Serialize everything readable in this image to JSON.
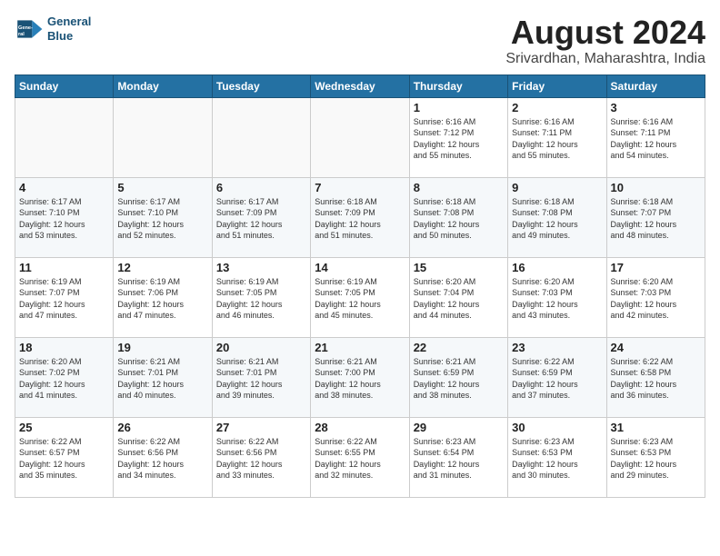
{
  "header": {
    "logo": {
      "line1": "General",
      "line2": "Blue"
    },
    "title": "August 2024",
    "subtitle": "Srivardhan, Maharashtra, India"
  },
  "weekdays": [
    "Sunday",
    "Monday",
    "Tuesday",
    "Wednesday",
    "Thursday",
    "Friday",
    "Saturday"
  ],
  "weeks": [
    [
      {
        "day": "",
        "info": ""
      },
      {
        "day": "",
        "info": ""
      },
      {
        "day": "",
        "info": ""
      },
      {
        "day": "",
        "info": ""
      },
      {
        "day": "1",
        "info": "Sunrise: 6:16 AM\nSunset: 7:12 PM\nDaylight: 12 hours\nand 55 minutes."
      },
      {
        "day": "2",
        "info": "Sunrise: 6:16 AM\nSunset: 7:11 PM\nDaylight: 12 hours\nand 55 minutes."
      },
      {
        "day": "3",
        "info": "Sunrise: 6:16 AM\nSunset: 7:11 PM\nDaylight: 12 hours\nand 54 minutes."
      }
    ],
    [
      {
        "day": "4",
        "info": "Sunrise: 6:17 AM\nSunset: 7:10 PM\nDaylight: 12 hours\nand 53 minutes."
      },
      {
        "day": "5",
        "info": "Sunrise: 6:17 AM\nSunset: 7:10 PM\nDaylight: 12 hours\nand 52 minutes."
      },
      {
        "day": "6",
        "info": "Sunrise: 6:17 AM\nSunset: 7:09 PM\nDaylight: 12 hours\nand 51 minutes."
      },
      {
        "day": "7",
        "info": "Sunrise: 6:18 AM\nSunset: 7:09 PM\nDaylight: 12 hours\nand 51 minutes."
      },
      {
        "day": "8",
        "info": "Sunrise: 6:18 AM\nSunset: 7:08 PM\nDaylight: 12 hours\nand 50 minutes."
      },
      {
        "day": "9",
        "info": "Sunrise: 6:18 AM\nSunset: 7:08 PM\nDaylight: 12 hours\nand 49 minutes."
      },
      {
        "day": "10",
        "info": "Sunrise: 6:18 AM\nSunset: 7:07 PM\nDaylight: 12 hours\nand 48 minutes."
      }
    ],
    [
      {
        "day": "11",
        "info": "Sunrise: 6:19 AM\nSunset: 7:07 PM\nDaylight: 12 hours\nand 47 minutes."
      },
      {
        "day": "12",
        "info": "Sunrise: 6:19 AM\nSunset: 7:06 PM\nDaylight: 12 hours\nand 47 minutes."
      },
      {
        "day": "13",
        "info": "Sunrise: 6:19 AM\nSunset: 7:05 PM\nDaylight: 12 hours\nand 46 minutes."
      },
      {
        "day": "14",
        "info": "Sunrise: 6:19 AM\nSunset: 7:05 PM\nDaylight: 12 hours\nand 45 minutes."
      },
      {
        "day": "15",
        "info": "Sunrise: 6:20 AM\nSunset: 7:04 PM\nDaylight: 12 hours\nand 44 minutes."
      },
      {
        "day": "16",
        "info": "Sunrise: 6:20 AM\nSunset: 7:03 PM\nDaylight: 12 hours\nand 43 minutes."
      },
      {
        "day": "17",
        "info": "Sunrise: 6:20 AM\nSunset: 7:03 PM\nDaylight: 12 hours\nand 42 minutes."
      }
    ],
    [
      {
        "day": "18",
        "info": "Sunrise: 6:20 AM\nSunset: 7:02 PM\nDaylight: 12 hours\nand 41 minutes."
      },
      {
        "day": "19",
        "info": "Sunrise: 6:21 AM\nSunset: 7:01 PM\nDaylight: 12 hours\nand 40 minutes."
      },
      {
        "day": "20",
        "info": "Sunrise: 6:21 AM\nSunset: 7:01 PM\nDaylight: 12 hours\nand 39 minutes."
      },
      {
        "day": "21",
        "info": "Sunrise: 6:21 AM\nSunset: 7:00 PM\nDaylight: 12 hours\nand 38 minutes."
      },
      {
        "day": "22",
        "info": "Sunrise: 6:21 AM\nSunset: 6:59 PM\nDaylight: 12 hours\nand 38 minutes."
      },
      {
        "day": "23",
        "info": "Sunrise: 6:22 AM\nSunset: 6:59 PM\nDaylight: 12 hours\nand 37 minutes."
      },
      {
        "day": "24",
        "info": "Sunrise: 6:22 AM\nSunset: 6:58 PM\nDaylight: 12 hours\nand 36 minutes."
      }
    ],
    [
      {
        "day": "25",
        "info": "Sunrise: 6:22 AM\nSunset: 6:57 PM\nDaylight: 12 hours\nand 35 minutes."
      },
      {
        "day": "26",
        "info": "Sunrise: 6:22 AM\nSunset: 6:56 PM\nDaylight: 12 hours\nand 34 minutes."
      },
      {
        "day": "27",
        "info": "Sunrise: 6:22 AM\nSunset: 6:56 PM\nDaylight: 12 hours\nand 33 minutes."
      },
      {
        "day": "28",
        "info": "Sunrise: 6:22 AM\nSunset: 6:55 PM\nDaylight: 12 hours\nand 32 minutes."
      },
      {
        "day": "29",
        "info": "Sunrise: 6:23 AM\nSunset: 6:54 PM\nDaylight: 12 hours\nand 31 minutes."
      },
      {
        "day": "30",
        "info": "Sunrise: 6:23 AM\nSunset: 6:53 PM\nDaylight: 12 hours\nand 30 minutes."
      },
      {
        "day": "31",
        "info": "Sunrise: 6:23 AM\nSunset: 6:53 PM\nDaylight: 12 hours\nand 29 minutes."
      }
    ]
  ]
}
